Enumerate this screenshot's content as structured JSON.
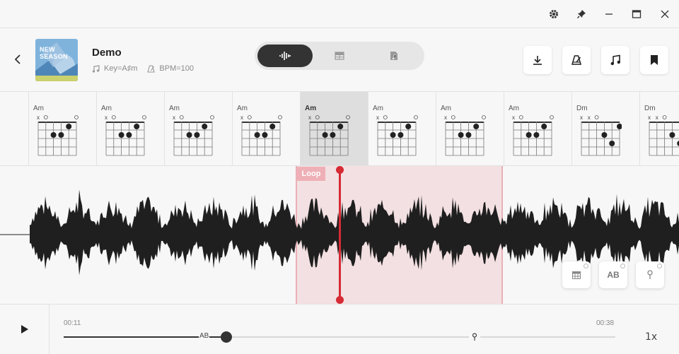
{
  "window": {
    "controls": [
      "gear-icon",
      "pin-icon",
      "minimize-icon",
      "maximize-icon",
      "close-icon"
    ]
  },
  "song": {
    "title": "Demo",
    "key_label": "Key=A♯m",
    "bpm_label": "BPM=100",
    "cover_text": "NEW SEASON"
  },
  "view_modes": [
    {
      "name": "waveform-mode",
      "icon": "waveform-icon",
      "active": true
    },
    {
      "name": "grid-mode",
      "icon": "grid-icon",
      "active": false
    },
    {
      "name": "sheet-mode",
      "icon": "sheet-music-icon",
      "active": false
    }
  ],
  "actions": [
    "download-icon",
    "metronome-icon",
    "music-note-icon",
    "bookmark-icon"
  ],
  "chords": [
    {
      "name": "Am",
      "active": false
    },
    {
      "name": "Am",
      "active": false
    },
    {
      "name": "Am",
      "active": false
    },
    {
      "name": "Am",
      "active": false
    },
    {
      "name": "Am",
      "active": true
    },
    {
      "name": "Am",
      "active": false
    },
    {
      "name": "Am",
      "active": false
    },
    {
      "name": "Am",
      "active": false
    },
    {
      "name": "Dm",
      "active": false
    },
    {
      "name": "Dm",
      "active": false
    }
  ],
  "loop": {
    "label": "Loop"
  },
  "float_tools": {
    "ab_label": "AB"
  },
  "player": {
    "current_time": "00:11",
    "total_time": "00:38",
    "ab_marker": "AB",
    "speed": "1x",
    "progress": 0.29
  },
  "colors": {
    "accent": "#d62a34",
    "loop_fill": "#f2dede",
    "dark": "#333333"
  }
}
